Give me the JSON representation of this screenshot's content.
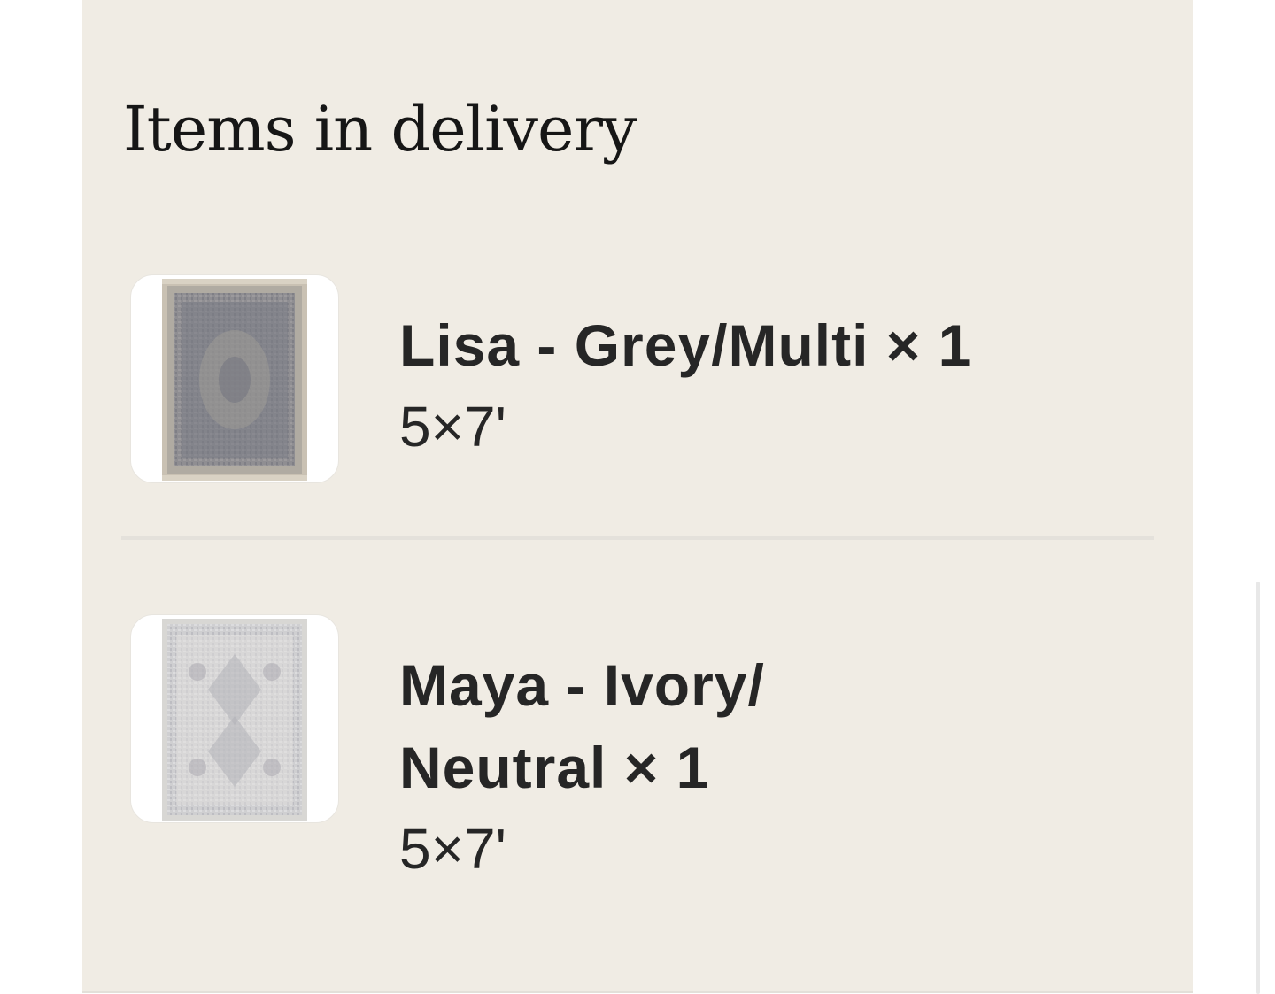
{
  "section": {
    "title": "Items in delivery"
  },
  "items": [
    {
      "name": "Lisa - Grey/Multi × 1",
      "size": "5×7'",
      "thumbnail_icon": "rug-image"
    },
    {
      "name": "Maya - Ivory/ Neutral × 1",
      "size": "5×7'",
      "thumbnail_icon": "rug-image"
    }
  ],
  "colors": {
    "panel_background": "#f0ece4",
    "text": "#262626",
    "divider": "#e4e1db"
  }
}
